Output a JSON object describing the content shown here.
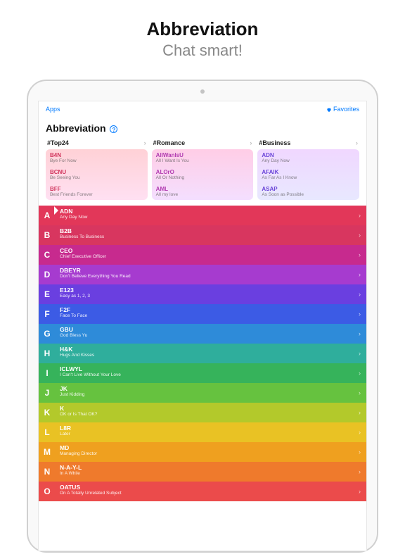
{
  "promo": {
    "title": "Abbreviation",
    "subtitle": "Chat smart!"
  },
  "nav": {
    "back": "Apps",
    "fav": "Favorites"
  },
  "page": {
    "title": "Abbreviation"
  },
  "cats": [
    {
      "key": "top24",
      "title": "#Top24",
      "items": [
        {
          "abbr": "B4N",
          "mean": "Bye For Now"
        },
        {
          "abbr": "BCNU",
          "mean": "Be Seeing You"
        },
        {
          "abbr": "BFF",
          "mean": "Best Friends Forever"
        }
      ]
    },
    {
      "key": "romance",
      "title": "#Romance",
      "items": [
        {
          "abbr": "AlIWanIsU",
          "mean": "All I Want Is You"
        },
        {
          "abbr": "ALOrO",
          "mean": "All Or Nothing"
        },
        {
          "abbr": "AML",
          "mean": "All my love"
        }
      ]
    },
    {
      "key": "business",
      "title": "#Business",
      "items": [
        {
          "abbr": "ADN",
          "mean": "Any Day Now"
        },
        {
          "abbr": "AFAIK",
          "mean": "As Far As I Know"
        },
        {
          "abbr": "ASAP",
          "mean": "As Soon as Possible"
        }
      ]
    }
  ],
  "alpha": [
    {
      "letter": "A",
      "abbr": "ADN",
      "mean": "Any Day Now"
    },
    {
      "letter": "B",
      "abbr": "B2B",
      "mean": "Business To Business"
    },
    {
      "letter": "C",
      "abbr": "CEO",
      "mean": "Chief Executive Officer"
    },
    {
      "letter": "D",
      "abbr": "DBEYR",
      "mean": "Don't Believe Everything You Read"
    },
    {
      "letter": "E",
      "abbr": "E123",
      "mean": "Easy as 1, 2, 3"
    },
    {
      "letter": "F",
      "abbr": "F2F",
      "mean": "Face To Face"
    },
    {
      "letter": "G",
      "abbr": "GBU",
      "mean": "God Bless Yu"
    },
    {
      "letter": "H",
      "abbr": "H&K",
      "mean": "Hugs And Kisses"
    },
    {
      "letter": "I",
      "abbr": "ICLWYL",
      "mean": "I Can't Live Without Your Love"
    },
    {
      "letter": "J",
      "abbr": "JK",
      "mean": "Just Kidding"
    },
    {
      "letter": "K",
      "abbr": "K",
      "mean": "OK or Is That OK?"
    },
    {
      "letter": "L",
      "abbr": "L8R",
      "mean": "Later"
    },
    {
      "letter": "M",
      "abbr": "MD",
      "mean": "Managing Director"
    },
    {
      "letter": "N",
      "abbr": "N-A-Y-L",
      "mean": "In A While"
    },
    {
      "letter": "O",
      "abbr": "OATUS",
      "mean": "On A Totally Unrelated Subject"
    }
  ]
}
